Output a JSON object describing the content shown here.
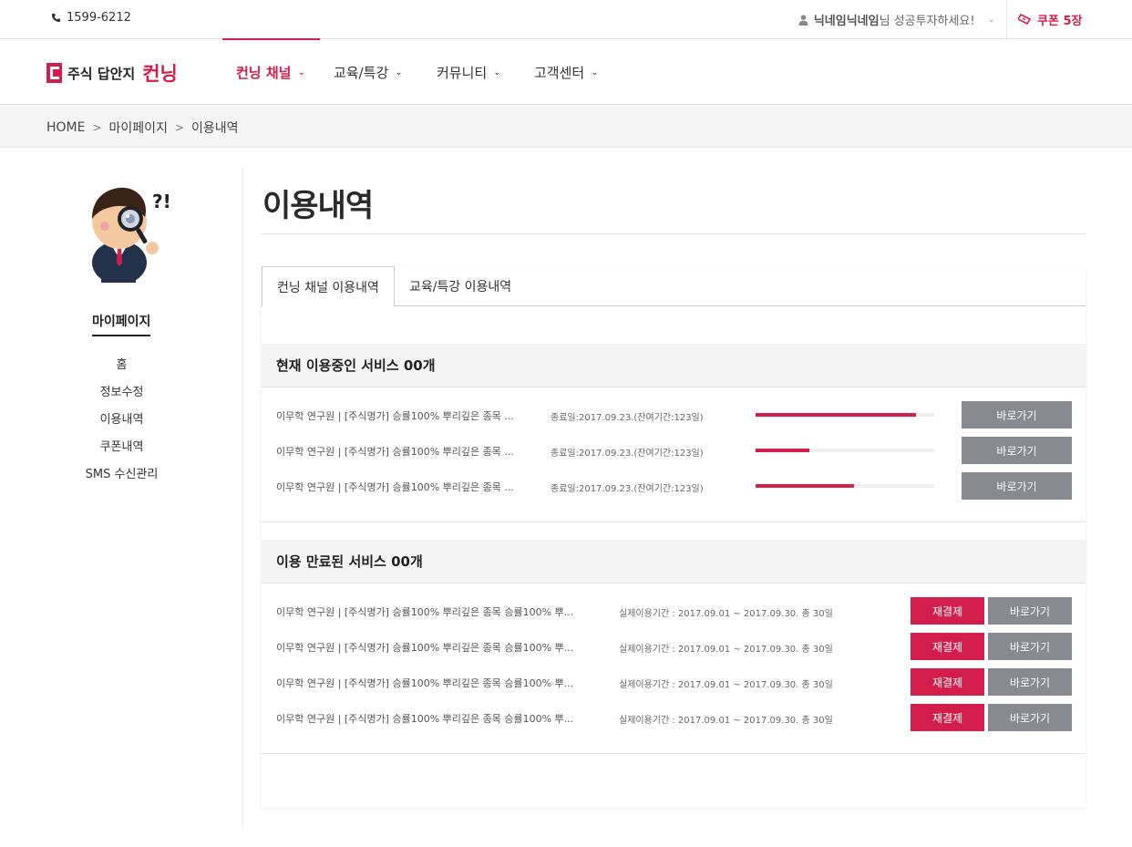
{
  "topbar": {
    "phone": "1599-6212",
    "user_nickname": "닉네임닉네임",
    "user_suffix": "님 성공투자하세요!",
    "coupon_label": "쿠폰 5장"
  },
  "header": {
    "logo_text": "주식 답안지",
    "logo_brand": "컨닝",
    "nav": [
      {
        "label": "컨닝 채널",
        "active": true
      },
      {
        "label": "교육/특강",
        "active": false
      },
      {
        "label": "커뮤니티",
        "active": false
      },
      {
        "label": "고객센터",
        "active": false
      }
    ]
  },
  "breadcrumb": [
    "HOME",
    "마이페이지",
    "이용내역"
  ],
  "sidebar": {
    "title": "마이페이지",
    "items": [
      "홈",
      "정보수정",
      "이용내역",
      "쿠폰내역",
      "SMS 수신관리"
    ]
  },
  "page_title": "이용내역",
  "tabs": [
    {
      "label": "컨닝 채널 이용내역",
      "active": true
    },
    {
      "label": "교육/특강 이용내역",
      "active": false
    }
  ],
  "current": {
    "heading": "현재 이용중인 서비스 00개",
    "rows": [
      {
        "title": "이무학 연구원 | [주식명가] 승률100% 뿌리깊은 종목 ...",
        "date": "종료일:2017.09.23.(잔여기간:123일)",
        "progress": 0.9,
        "button": "바로가기"
      },
      {
        "title": "이무학 연구원 | [주식명가] 승률100% 뿌리깊은 종목 ...",
        "date": "종료일:2017.09.23.(잔여기간:123일)",
        "progress": 0.3,
        "button": "바로가기"
      },
      {
        "title": "이무학 연구원 | [주식명가] 승률100% 뿌리깊은 종목 ...",
        "date": "종료일:2017.09.23.(잔여기간:123일)",
        "progress": 0.55,
        "button": "바로가기"
      }
    ]
  },
  "expired": {
    "heading": "이용 만료된 서비스 00개",
    "rows": [
      {
        "title": "이무학 연구원 | [주식명가] 승률100% 뿌리깊은 종목 승률100% 뿌...",
        "date": "실제이용기간 : 2017.09.01 ~ 2017.09.30. 총 30일",
        "renew": "재결제",
        "button": "바로가기"
      },
      {
        "title": "이무학 연구원 | [주식명가] 승률100% 뿌리깊은 종목 승률100% 뿌...",
        "date": "실제이용기간 : 2017.09.01 ~ 2017.09.30. 총 30일",
        "renew": "재결제",
        "button": "바로가기"
      },
      {
        "title": "이무학 연구원 | [주식명가] 승률100% 뿌리깊은 종목 승률100% 뿌...",
        "date": "실제이용기간 : 2017.09.01 ~ 2017.09.30. 총 30일",
        "renew": "재결제",
        "button": "바로가기"
      },
      {
        "title": "이무학 연구원 | [주식명가] 승률100% 뿌리깊은 종목 승률100% 뿌...",
        "date": "실제이용기간 : 2017.09.01 ~ 2017.09.30. 총 30일",
        "renew": "재결제",
        "button": "바로가기"
      }
    ]
  },
  "colors": {
    "accent": "#d31e4b",
    "button_gray": "#878a91"
  }
}
